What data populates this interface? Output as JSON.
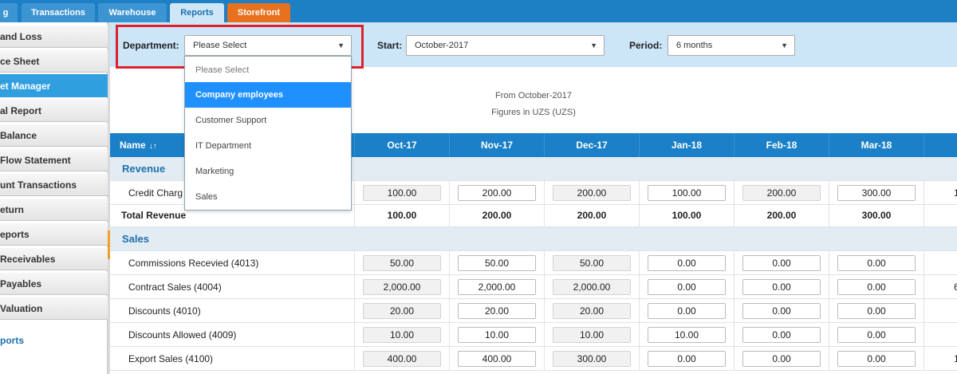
{
  "nav": {
    "tabs": [
      {
        "label": "g"
      },
      {
        "label": "Transactions"
      },
      {
        "label": "Warehouse"
      },
      {
        "label": "Reports"
      },
      {
        "label": "Storefront"
      }
    ]
  },
  "sidebar": {
    "items": [
      {
        "label": "and Loss"
      },
      {
        "label": "ce Sheet"
      },
      {
        "label": "et Manager"
      },
      {
        "label": "al Report"
      },
      {
        "label": "Balance"
      },
      {
        "label": "Flow Statement"
      },
      {
        "label": "unt Transactions"
      },
      {
        "label": "eturn"
      },
      {
        "label": "eports"
      },
      {
        "label": "Receivables"
      },
      {
        "label": "Payables"
      },
      {
        "label": "Valuation"
      }
    ],
    "link": "ports"
  },
  "filters": {
    "department_label": "Department:",
    "department_value": "Please Select",
    "start_label": "Start:",
    "start_value": "October-2017",
    "period_label": "Period:",
    "period_value": "6 months"
  },
  "dropdown": {
    "options": [
      "Please Select",
      "Company employees",
      "Customer Support",
      "IT Department",
      "Marketing",
      "Sales"
    ],
    "highlighted": "Company employees"
  },
  "report": {
    "from_text": "From October-2017",
    "figures_text": "Figures in UZS (UZS)"
  },
  "table": {
    "name_header": "Name",
    "months": [
      "Oct-17",
      "Nov-17",
      "Dec-17",
      "Jan-18",
      "Feb-18",
      "Mar-18"
    ],
    "sections": {
      "revenue": "Revenue",
      "sales": "Sales"
    },
    "revenue_rows": [
      {
        "label": "Credit Charg",
        "values": [
          "100.00",
          "200.00",
          "200.00",
          "100.00",
          "200.00",
          "300.00"
        ],
        "overflow": "1"
      }
    ],
    "total_revenue": {
      "label": "Total Revenue",
      "values": [
        "100.00",
        "200.00",
        "200.00",
        "100.00",
        "200.00",
        "300.00"
      ]
    },
    "sales_rows": [
      {
        "label": "Commissions Recevied (4013)",
        "values": [
          "50.00",
          "50.00",
          "50.00",
          "0.00",
          "0.00",
          "0.00"
        ],
        "overflow": ""
      },
      {
        "label": "Contract Sales (4004)",
        "values": [
          "2,000.00",
          "2,000.00",
          "2,000.00",
          "0.00",
          "0.00",
          "0.00"
        ],
        "overflow": "6"
      },
      {
        "label": "Discounts (4010)",
        "values": [
          "20.00",
          "20.00",
          "20.00",
          "0.00",
          "0.00",
          "0.00"
        ],
        "overflow": ""
      },
      {
        "label": "Discounts Allowed (4009)",
        "values": [
          "10.00",
          "10.00",
          "10.00",
          "10.00",
          "0.00",
          "0.00"
        ],
        "overflow": ""
      },
      {
        "label": "Export Sales (4100)",
        "values": [
          "400.00",
          "400.00",
          "300.00",
          "0.00",
          "0.00",
          "0.00"
        ],
        "overflow": "1"
      }
    ]
  }
}
